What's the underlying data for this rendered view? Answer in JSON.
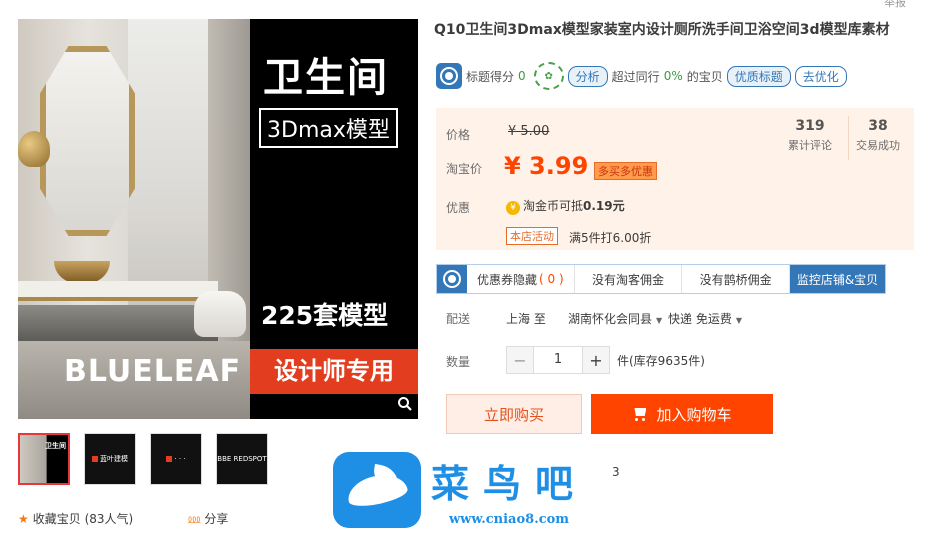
{
  "header": {
    "report_link": "举报"
  },
  "main_image": {
    "title": "卫生间",
    "subtitle": "3Dmax模型",
    "count_text": "225套模型",
    "banner_text": "设计师专用",
    "brand_mark": "BLUELEAF",
    "zoom_icon": "search-icon"
  },
  "thumbnails": [
    {
      "label": "卫生间"
    },
    {
      "label": "蓝叶建模"
    },
    {
      "label": "· · ·"
    },
    {
      "label": "BBE REDSPOT"
    }
  ],
  "product": {
    "title": "Q10卫生间3Dmax模型家装室内设计厕所洗手间卫浴空间3d模型库素材"
  },
  "score_bar": {
    "label": "标题得分",
    "score": "0",
    "analyze": "分析",
    "exceed_prefix": "超过同行",
    "exceed_pct": "0%",
    "exceed_suffix": "的宝贝",
    "quality_title": "优质标题",
    "optimize": "去优化"
  },
  "price": {
    "original_label": "价格",
    "original_price": "¥ 5.00",
    "taobao_label": "淘宝价",
    "taobao_price": "¥ 3.99",
    "promo_tag": "多买多优惠",
    "discount_label": "优惠",
    "coin_text_prefix": "淘金币可抵",
    "coin_amount": "0.19元",
    "shop_activity_tag": "本店活动",
    "shop_activity_text": "满5件打6.00折"
  },
  "stats": [
    {
      "value": "319",
      "label": "累计评论"
    },
    {
      "value": "38",
      "label": "交易成功"
    }
  ],
  "coupon_bar": {
    "items": [
      {
        "label": "优惠券隐藏",
        "count": "( 0 )"
      },
      {
        "label": "没有淘客佣金"
      },
      {
        "label": "没有鹊桥佣金"
      }
    ],
    "highlight": "监控店铺&宝贝"
  },
  "shipping": {
    "label": "配送",
    "from": "上海 至",
    "to": "湖南怀化会同县",
    "method": "快递 免运费"
  },
  "quantity": {
    "label": "数量",
    "value": "1",
    "stock_text": "件(库存9635件)"
  },
  "actions": {
    "buy_now": "立即购买",
    "add_to_cart": "加入购物车"
  },
  "footer": {
    "collect": "收藏宝贝 (83人气)",
    "share": "分享",
    "stray_text": "3"
  },
  "watermark": {
    "name": "菜鸟吧",
    "url": "www.cniao8.com"
  },
  "colors": {
    "accent": "#ff4400",
    "plugin_blue": "#3377b8",
    "price_panel_bg": "#fff2e8"
  }
}
